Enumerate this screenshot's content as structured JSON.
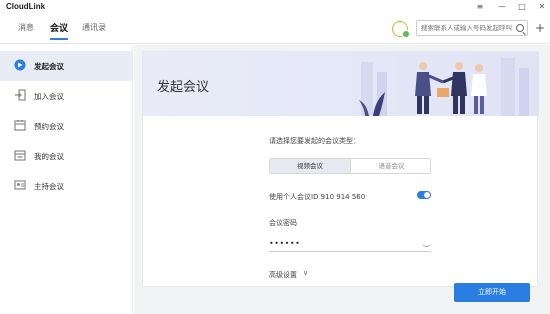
{
  "app": {
    "title": "CloudLink"
  },
  "window": {
    "menu_icon": "≡",
    "min_icon": "—",
    "max_icon": "□",
    "close_icon": "✕"
  },
  "nav": {
    "tabs": [
      {
        "label": "消息"
      },
      {
        "label": "会议"
      },
      {
        "label": "通讯录"
      }
    ],
    "active_index": 1
  },
  "search": {
    "placeholder": "搜索联系人或输入号码发起呼叫"
  },
  "add_icon": "+",
  "sidebar": {
    "items": [
      {
        "label": "发起会议",
        "icon": "meeting-start-icon"
      },
      {
        "label": "加入会议",
        "icon": "join-icon"
      },
      {
        "label": "预约会议",
        "icon": "calendar-icon"
      },
      {
        "label": "我的会议",
        "icon": "calendar-list-icon"
      },
      {
        "label": "主持会议",
        "icon": "host-icon"
      }
    ],
    "active_index": 0
  },
  "main": {
    "banner_title": "发起会议",
    "prompt": "请选择您要发起的会议类型：",
    "types": [
      "视频会议",
      "语音会议"
    ],
    "selected_type": "视频会议",
    "pmi_label": "使用个人会议ID 910 914 560",
    "pmi_enabled": true,
    "password_label": "会议密码",
    "password_value": "••••••",
    "advanced_label": "高级设置",
    "advanced_chevron": "∨",
    "start_button": "立即开始"
  },
  "colors": {
    "accent": "#2a7de1",
    "active_bg": "#e8edf5"
  }
}
